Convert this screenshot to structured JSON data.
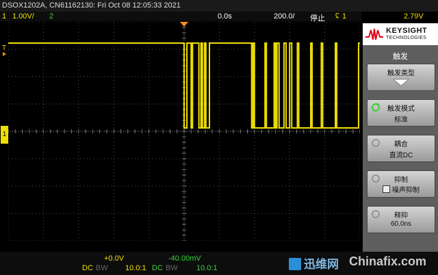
{
  "status": {
    "model_line": "DSOX1202A, CN61162130: Fri Oct 08 12:05:33 2021",
    "ch1_number": "1",
    "ch1_scale": "1.00V/",
    "ch2_number": "2",
    "time_delay": "0.0s",
    "time_scale": "200.0/",
    "run_state": "停止",
    "trigger_source": "1",
    "trigger_level": "2.79V"
  },
  "markers": {
    "trigger_marker": "T",
    "ground_marker": "1"
  },
  "softkeys": {
    "brand_name": "KEYSIGHT",
    "brand_sub": "TECHNOLOGIES",
    "menu_title": "触发",
    "trigger_type_label": "触发类型",
    "trigger_mode_label": "触发模式",
    "trigger_mode_value": "标准",
    "coupling_label": "耦合",
    "coupling_value": "直流DC",
    "reject_label": "抑制",
    "noise_reject_label": "噪声抑制",
    "holdoff_label": "释抑",
    "holdoff_value": "60.0ns"
  },
  "bottom": {
    "ch1_offset": "+0.0V",
    "ch2_offset": "-40.00mV",
    "ch1_coupling": "DC",
    "ch1_bw": "BW",
    "ch1_probe": "10.0:1",
    "ch2_coupling": "DC",
    "ch2_bw": "BW",
    "ch2_probe": "10.0:1"
  },
  "watermark": {
    "cn_text": "迅维网",
    "en_text": "Chinafix.com"
  },
  "colors": {
    "ch1": "#f0e000",
    "ch2": "#39d13a",
    "trigger": "#ff8c1a",
    "grid": "#555555"
  },
  "waveform": {
    "time_divisions": 10,
    "volt_divisions": 8,
    "high_level_div": 1.2,
    "low_level_div": -0.3,
    "segments": [
      {
        "t": 0.0,
        "level": 1
      },
      {
        "t": 5.0,
        "level": 0
      },
      {
        "t": 5.08,
        "level": 1
      },
      {
        "t": 5.2,
        "level": 0
      },
      {
        "t": 5.24,
        "level": 1
      },
      {
        "t": 5.42,
        "level": 0
      },
      {
        "t": 5.48,
        "level": 1
      },
      {
        "t": 5.52,
        "level": 0
      },
      {
        "t": 5.58,
        "level": 1
      },
      {
        "t": 5.62,
        "level": 0
      },
      {
        "t": 5.72,
        "level": 1
      },
      {
        "t": 6.92,
        "level": 0
      },
      {
        "t": 6.96,
        "level": 1
      },
      {
        "t": 7.0,
        "level": 0
      },
      {
        "t": 7.3,
        "level": 1
      },
      {
        "t": 7.34,
        "level": 0
      },
      {
        "t": 7.56,
        "level": 1
      },
      {
        "t": 7.6,
        "level": 0
      },
      {
        "t": 7.64,
        "level": 1
      },
      {
        "t": 7.7,
        "level": 0
      },
      {
        "t": 7.84,
        "level": 1
      },
      {
        "t": 7.9,
        "level": 0
      },
      {
        "t": 8.0,
        "level": 1
      },
      {
        "t": 8.06,
        "level": 0
      },
      {
        "t": 8.22,
        "level": 1
      },
      {
        "t": 8.26,
        "level": 0
      },
      {
        "t": 8.6,
        "level": 1
      },
      {
        "t": 8.64,
        "level": 0
      },
      {
        "t": 8.9,
        "level": 1
      },
      {
        "t": 8.94,
        "level": 0
      },
      {
        "t": 9.3,
        "level": 1
      },
      {
        "t": 9.34,
        "level": 0
      },
      {
        "t": 9.96,
        "level": 1
      },
      {
        "t": 10.0,
        "level": 1
      }
    ]
  }
}
